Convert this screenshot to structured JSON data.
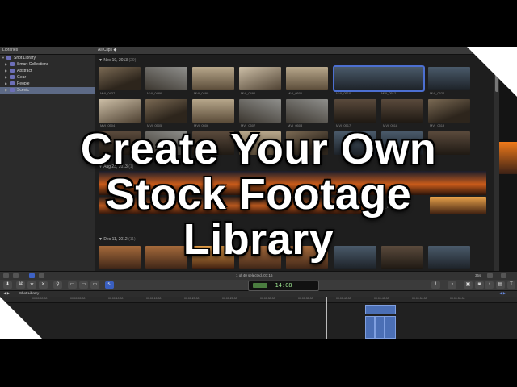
{
  "pane_headers": {
    "libraries": "Libraries",
    "browser_filter": "All Clips ◆"
  },
  "sidebar": {
    "items": [
      {
        "label": "Shot Library",
        "selected": false
      },
      {
        "label": "Smart Collections",
        "selected": false
      },
      {
        "label": "Abstract",
        "selected": false
      },
      {
        "label": "Gear",
        "selected": false
      },
      {
        "label": "People",
        "selected": false
      },
      {
        "label": "Scenic",
        "selected": true
      }
    ]
  },
  "browser": {
    "groups": [
      {
        "date": "Nov 19, 2013",
        "count": "(29)"
      },
      {
        "date": "Aug 23, 2013",
        "count": "(1)"
      },
      {
        "date": "Dec 11, 2012",
        "count": "(11)"
      }
    ],
    "row1_names": [
      "MVI_0437",
      "MVI_0486",
      "MVI_0490",
      "MVI_0496",
      "MVI_0501",
      "MVI_0510",
      "MVI_0512",
      "MVI_0522"
    ],
    "row2_names": [
      "MVI_0504",
      "MVI_0505",
      "MVI_0506",
      "MVI_0507",
      "MVI_0508",
      "MVI_0517",
      "MVI_0518",
      "MVI_0519"
    ],
    "side_clip_name": "2013-08-23_19_34"
  },
  "toolbar": {
    "selection_status": "1 of 40 selected, 07:16",
    "duration_label": "35s"
  },
  "timeline": {
    "timecode": "14:08",
    "project_name": "Shot Library",
    "ruler_ticks": [
      "00:00:00:00",
      "00:00:05:00",
      "00:00:10:00",
      "00:00:15:00",
      "00:00:20:00",
      "00:00:25:00",
      "00:00:30:00",
      "00:00:35:00",
      "00:00:40:00",
      "00:00:45:00",
      "00:00:50:00",
      "00:00:55:00"
    ]
  },
  "overlay": {
    "line1": "Create Your Own",
    "line2": "Stock Footage",
    "line3": "Library"
  },
  "colors": {
    "accent_blue": "#3e62c5",
    "timecode_green": "#9be38f",
    "selection": "#5d6a86"
  }
}
